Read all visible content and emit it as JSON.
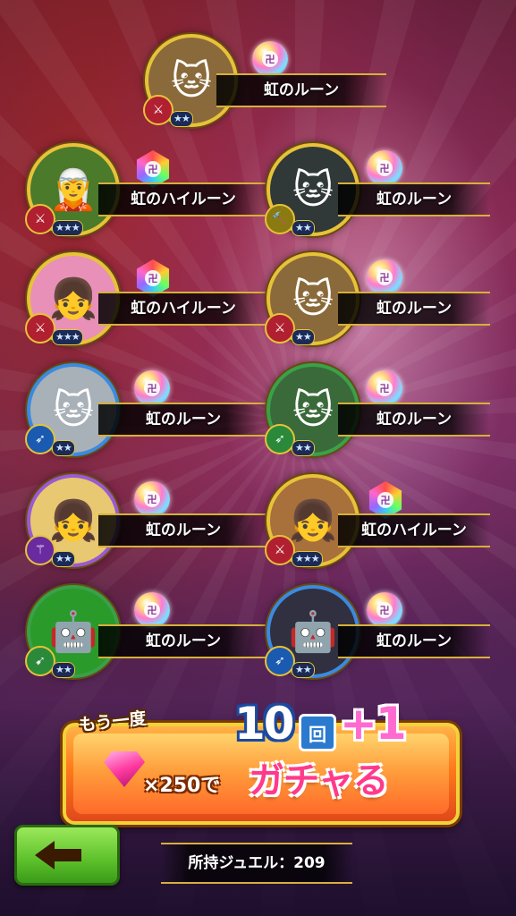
{
  "results": [
    {
      "slot": "r1",
      "class_icon": "sword-icon",
      "class_color": "#b02030",
      "stars": "★★",
      "rune_type": "normal",
      "name": "虹のルーン",
      "portrait_color": "#8a6a3a",
      "portrait_glyph": "🐱"
    },
    {
      "slot": "r2",
      "class_icon": "sword-icon",
      "class_color": "#b02030",
      "stars": "★★★",
      "rune_type": "hi",
      "name": "虹のハイルーン",
      "portrait_color": "#4a7a2a",
      "portrait_glyph": "🧝"
    },
    {
      "slot": "r3",
      "class_icon": "hammer-icon",
      "class_color": "#8a7a10",
      "stars": "★★",
      "rune_type": "normal",
      "name": "虹のルーン",
      "portrait_color": "#303838",
      "portrait_glyph": "🐱"
    },
    {
      "slot": "r4",
      "class_icon": "sword-icon",
      "class_color": "#b02030",
      "stars": "★★★",
      "rune_type": "hi",
      "name": "虹のハイルーン",
      "portrait_color": "#e890b8",
      "portrait_glyph": "👧"
    },
    {
      "slot": "r5",
      "class_icon": "sword-icon",
      "class_color": "#b02030",
      "stars": "★★",
      "rune_type": "normal",
      "name": "虹のルーン",
      "portrait_color": "#8a6a3a",
      "portrait_glyph": "🐱"
    },
    {
      "slot": "r6",
      "class_icon": "bow-icon",
      "class_color": "#1a5ab0",
      "stars": "★★",
      "rune_type": "normal",
      "name": "虹のルーン",
      "portrait_color": "#a8b0b8",
      "portrait_glyph": "🐱"
    },
    {
      "slot": "r7",
      "class_icon": "bow-icon",
      "class_color": "#2a8a3a",
      "stars": "★★",
      "rune_type": "normal",
      "name": "虹のルーン",
      "portrait_color": "#3a6a3a",
      "portrait_glyph": "🐱"
    },
    {
      "slot": "r8",
      "class_icon": "staff-icon",
      "class_color": "#6a2aa0",
      "stars": "★★",
      "rune_type": "normal",
      "name": "虹のルーン",
      "portrait_color": "#e8c870",
      "portrait_glyph": "👧"
    },
    {
      "slot": "r9",
      "class_icon": "sword-icon",
      "class_color": "#b02030",
      "stars": "★★★",
      "rune_type": "hi",
      "name": "虹のハイルーン",
      "portrait_color": "#a8703a",
      "portrait_glyph": "👧"
    },
    {
      "slot": "r10",
      "class_icon": "spear-icon",
      "class_color": "#2a8a3a",
      "stars": "★★",
      "rune_type": "normal",
      "name": "虹のルーン",
      "portrait_color": "#2a9a2a",
      "portrait_glyph": "🤖"
    },
    {
      "slot": "r11",
      "class_icon": "bow-icon",
      "class_color": "#1a5ab0",
      "stars": "★★",
      "rune_type": "normal",
      "name": "虹のルーン",
      "portrait_color": "#303040",
      "portrait_glyph": "🤖"
    }
  ],
  "gacha": {
    "again_label": "もう一度",
    "count_label": "10",
    "count_unit": "回",
    "bonus_label": "+1",
    "cost_label": "×250で",
    "action_label": "ガチャる"
  },
  "footer": {
    "jewel_label": "所持ジュエル：209"
  },
  "colors": {
    "frame_gold": "#e7c23a",
    "button_orange": "#ff7a1a",
    "back_green": "#5cc02a"
  }
}
